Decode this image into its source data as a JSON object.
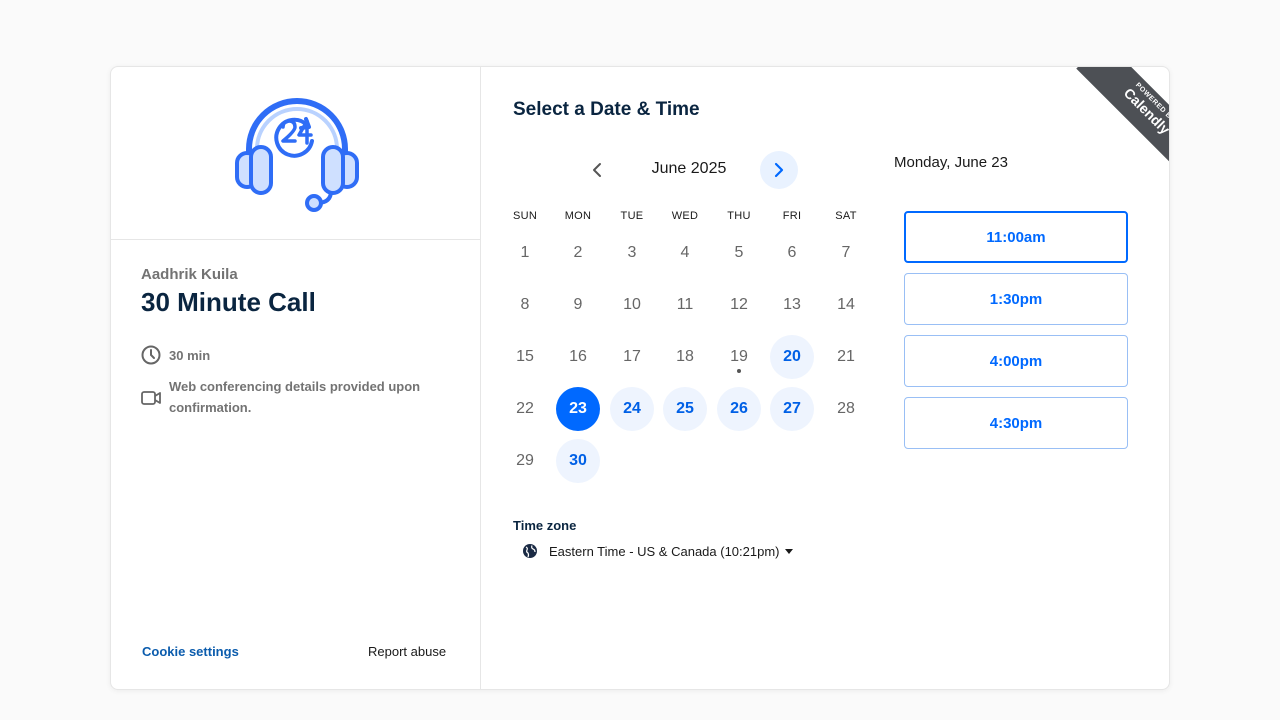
{
  "host_name": "Aadhrik Kuila",
  "event_title": "30 Minute Call",
  "duration": "30 min",
  "conferencing": "Web conferencing details provided upon confirmation.",
  "footer": {
    "cookie": "Cookie settings",
    "report": "Report abuse"
  },
  "select_title": "Select a Date & Time",
  "calendar": {
    "month_label": "June 2025",
    "weekdays": [
      "SUN",
      "MON",
      "TUE",
      "WED",
      "THU",
      "FRI",
      "SAT"
    ],
    "weeks": [
      [
        {
          "d": "1",
          "s": "plain"
        },
        {
          "d": "2",
          "s": "plain"
        },
        {
          "d": "3",
          "s": "plain"
        },
        {
          "d": "4",
          "s": "plain"
        },
        {
          "d": "5",
          "s": "plain"
        },
        {
          "d": "6",
          "s": "plain"
        },
        {
          "d": "7",
          "s": "plain"
        }
      ],
      [
        {
          "d": "8",
          "s": "plain"
        },
        {
          "d": "9",
          "s": "plain"
        },
        {
          "d": "10",
          "s": "plain"
        },
        {
          "d": "11",
          "s": "plain"
        },
        {
          "d": "12",
          "s": "plain"
        },
        {
          "d": "13",
          "s": "plain"
        },
        {
          "d": "14",
          "s": "plain"
        }
      ],
      [
        {
          "d": "15",
          "s": "plain"
        },
        {
          "d": "16",
          "s": "plain"
        },
        {
          "d": "17",
          "s": "plain"
        },
        {
          "d": "18",
          "s": "plain"
        },
        {
          "d": "19",
          "s": "today"
        },
        {
          "d": "20",
          "s": "avail"
        },
        {
          "d": "21",
          "s": "plain"
        }
      ],
      [
        {
          "d": "22",
          "s": "plain"
        },
        {
          "d": "23",
          "s": "selected"
        },
        {
          "d": "24",
          "s": "avail"
        },
        {
          "d": "25",
          "s": "avail"
        },
        {
          "d": "26",
          "s": "avail"
        },
        {
          "d": "27",
          "s": "avail"
        },
        {
          "d": "28",
          "s": "plain"
        }
      ],
      [
        {
          "d": "29",
          "s": "plain"
        },
        {
          "d": "30",
          "s": "avail"
        }
      ]
    ]
  },
  "timezone": {
    "label": "Time zone",
    "value": "Eastern Time - US & Canada (10:21pm)"
  },
  "selected_date": "Monday, June 23",
  "time_slots": [
    "11:00am",
    "1:30pm",
    "4:00pm",
    "4:30pm"
  ],
  "badge": {
    "powered_by": "POWERED BY",
    "brand": "Calendly"
  },
  "colors": {
    "primary": "#0069ff",
    "available_bg": "#eef4fe",
    "title": "#0a2540",
    "ribbon": "#4d5055"
  },
  "icons": {
    "logo": "headset-24-icon",
    "clock": "clock-icon",
    "video": "video-camera-icon",
    "globe": "globe-icon"
  }
}
